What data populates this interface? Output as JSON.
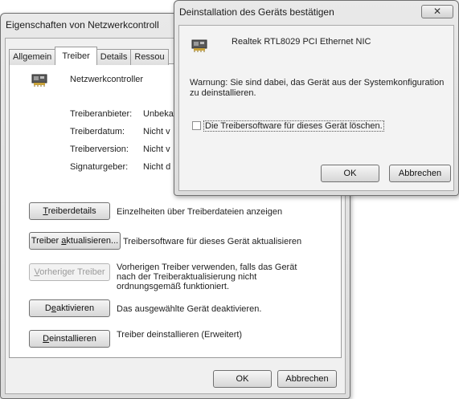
{
  "properties_window": {
    "title": "Eigenschaften von Netzwerkcontroll",
    "tabs": [
      "Allgemein",
      "Treiber",
      "Details",
      "Ressou"
    ],
    "device_name": "Netzwerkcontroller",
    "info": [
      {
        "label": "Treiberanbieter:",
        "value": "Unbeka"
      },
      {
        "label": "Treiberdatum:",
        "value": "Nicht v"
      },
      {
        "label": "Treiberversion:",
        "value": "Nicht v"
      },
      {
        "label": "Signaturgeber:",
        "value": "Nicht d"
      }
    ],
    "actions": [
      {
        "button_pre": "",
        "button_u": "T",
        "button_post": "reiberdetails",
        "description": "Einzelheiten über Treiberdateien anzeigen"
      },
      {
        "button_pre": "Treiber ",
        "button_u": "a",
        "button_post": "ktualisieren...",
        "description": "Treibersoftware für dieses Gerät aktualisieren"
      },
      {
        "button_pre": "",
        "button_u": "V",
        "button_post": "orheriger Treiber",
        "description": "Vorherigen Treiber verwenden, falls das Gerät nach der Treiberaktualisierung nicht ordnungsgemäß funktioniert."
      },
      {
        "button_pre": "D",
        "button_u": "e",
        "button_post": "aktivieren",
        "description": "Das ausgewählte Gerät deaktivieren."
      },
      {
        "button_pre": "",
        "button_u": "D",
        "button_post": "einstallieren",
        "description": "Treiber deinstallieren (Erweitert)"
      }
    ],
    "ok_label": "OK",
    "cancel_label": "Abbrechen"
  },
  "confirm_dialog": {
    "title": "Deinstallation des Geräts bestätigen",
    "close_glyph": "✕",
    "device_name": "Realtek RTL8029 PCI Ethernet NIC",
    "warning": "Warnung: Sie sind dabei, das Gerät aus der Systemkonfiguration zu deinstallieren.",
    "checkbox_label": "Die Treibersoftware für dieses Gerät löschen.",
    "checkbox_checked": false,
    "ok_label": "OK",
    "cancel_label": "Abbrechen"
  }
}
